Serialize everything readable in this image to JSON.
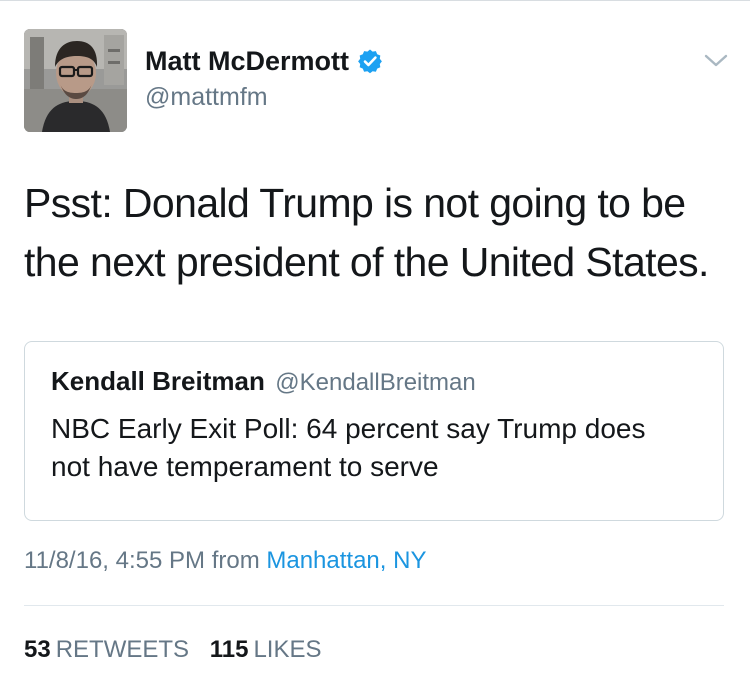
{
  "author": {
    "name": "Matt McDermott",
    "handle": "@mattmfm",
    "verified": true
  },
  "tweet": {
    "text": "Psst: Donald Trump is not going to be the next president of the United States."
  },
  "quoted_tweet": {
    "name": "Kendall Breitman",
    "handle": "@KendallBreitman",
    "text": "NBC Early Exit Poll: 64 percent say Trump does not have temperament to serve"
  },
  "meta": {
    "timestamp": "11/8/16, 4:55 PM",
    "from_word": "from",
    "location": "Manhattan, NY"
  },
  "stats": {
    "retweets_count": "53",
    "retweets_label": "RETWEETS",
    "likes_count": "115",
    "likes_label": "LIKES"
  },
  "icons": {
    "verified": "verified-badge-icon",
    "menu": "chevron-down-icon"
  },
  "colors": {
    "link_blue": "#1b95e0",
    "secondary_gray": "#657786",
    "primary_text": "#14171a",
    "verified_blue": "#1da1f2"
  }
}
